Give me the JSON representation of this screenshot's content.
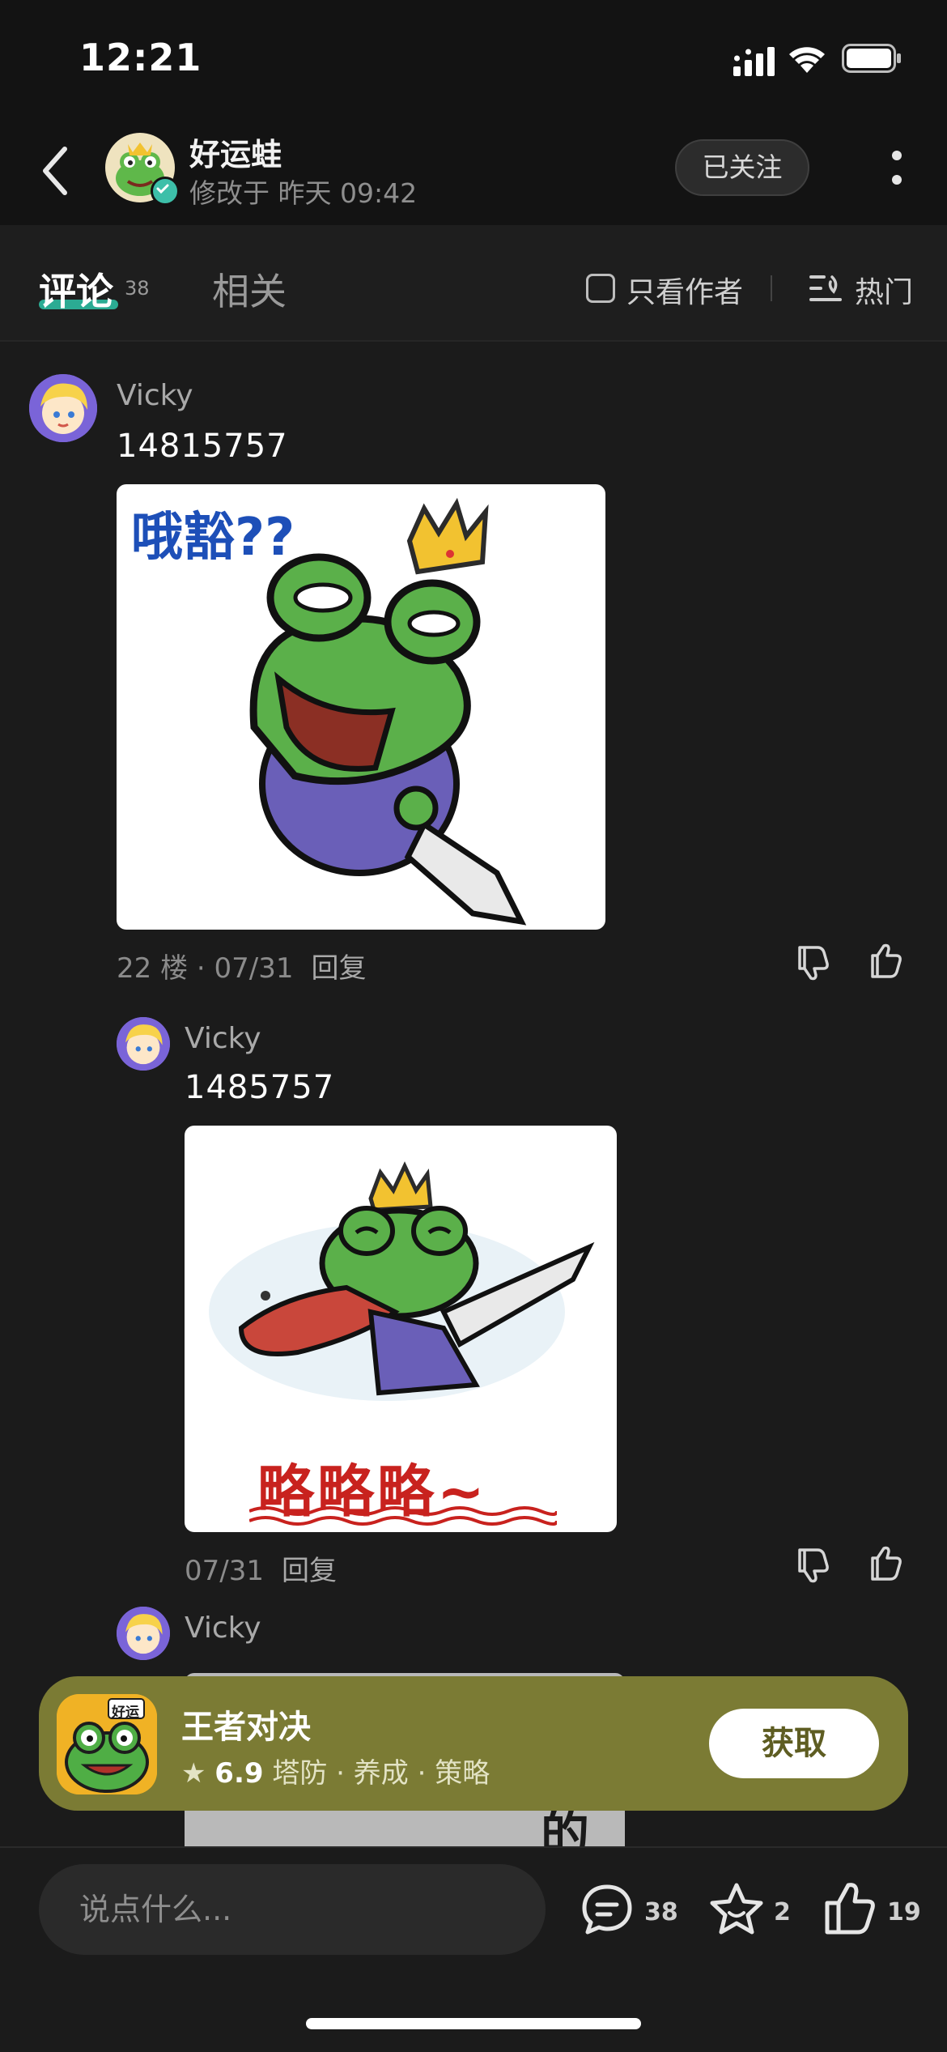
{
  "status_bar": {
    "time": "12:21"
  },
  "header": {
    "author_name": "好运蛙",
    "edit_time": "修改于 昨天 09:42",
    "follow_label": "已关注"
  },
  "tabs": {
    "comments_label": "评论",
    "comments_count": "38",
    "related_label": "相关",
    "author_only_label": "只看作者",
    "sort_label": "热门"
  },
  "comments": [
    {
      "username": "Vicky",
      "text": "14815757",
      "image_caption": "哦豁??",
      "floor": "22 楼 · 07/31",
      "reply_label": "回复"
    },
    {
      "username": "Vicky",
      "text": "1485757",
      "image_caption": "略略略~",
      "floor": "07/31",
      "reply_label": "回复"
    },
    {
      "username": "Vicky",
      "partial_image_caption": "的"
    }
  ],
  "ad": {
    "icon_label": "好运",
    "title": "王者对决",
    "rating": "6.9",
    "tags": "塔防 · 养成 · 策略",
    "button_label": "获取"
  },
  "bottom_bar": {
    "input_placeholder": "说点什么...",
    "comment_count": "38",
    "favorite_count": "2",
    "like_count": "19"
  },
  "colors": {
    "background": "#1b1b1b",
    "accent": "#2ec4a8",
    "ad_background": "#7b7b34"
  }
}
